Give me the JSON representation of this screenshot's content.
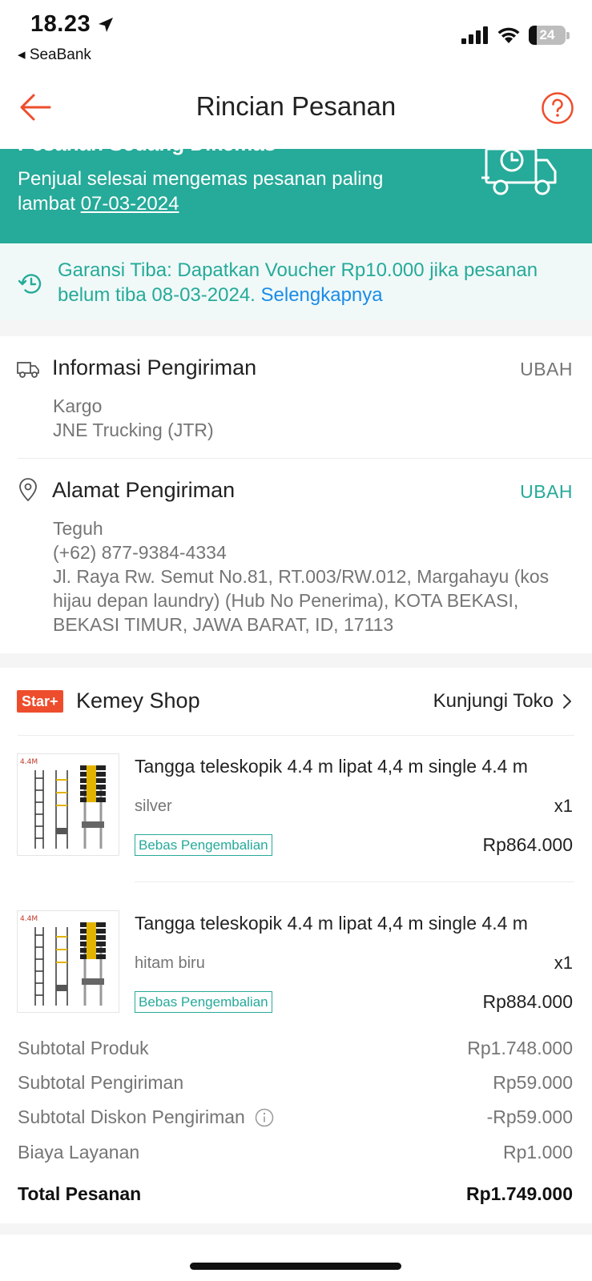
{
  "status_bar": {
    "time": "18.23",
    "back_app": "◂ SeaBank",
    "battery": "24"
  },
  "header": {
    "title": "Rincian Pesanan"
  },
  "banner": {
    "title_cut": "Pesanan Sedang Dikemas",
    "text_before": "Penjual selesai mengemas pesanan paling lambat ",
    "date": "07-03-2024",
    "color": "#26aa99"
  },
  "guarantee": {
    "text": "Garansi Tiba: Dapatkan Voucher Rp10.000 jika pesanan belum tiba 08-03-2024. ",
    "link": "Selengkapnya"
  },
  "shipping_info": {
    "title": "Informasi Pengiriman",
    "action": "UBAH",
    "line1": "Kargo",
    "line2": "JNE Trucking (JTR)"
  },
  "address": {
    "title": "Alamat Pengiriman",
    "action": "UBAH",
    "name": "Teguh",
    "phone": "(+62) 877-9384-4334",
    "address": "Jl. Raya Rw. Semut No.81, RT.003/RW.012, Margahayu (kos hijau depan laundry) (Hub No Penerima), KOTA BEKASI, BEKASI TIMUR, JAWA BARAT, ID, 17113"
  },
  "shop": {
    "badge": "Star+",
    "name": "Kemey Shop",
    "visit": "Kunjungi Toko"
  },
  "products": [
    {
      "name": "Tangga teleskopik 4.4 m lipat 4,4 m single 4.4 m",
      "variant": "silver",
      "qty": "x1",
      "badge": "Bebas Pengembalian",
      "price": "Rp864.000",
      "img_label": "4.4M"
    },
    {
      "name": "Tangga teleskopik 4.4 m lipat 4,4 m single 4.4 m",
      "variant": "hitam biru",
      "qty": "x1",
      "badge": "Bebas Pengembalian",
      "price": "Rp884.000",
      "img_label": "4.4M"
    }
  ],
  "summary": {
    "subtotal_product_label": "Subtotal Produk",
    "subtotal_product": "Rp1.748.000",
    "subtotal_shipping_label": "Subtotal Pengiriman",
    "subtotal_shipping": "Rp59.000",
    "shipping_discount_label": "Subtotal Diskon Pengiriman",
    "shipping_discount": "-Rp59.000",
    "service_fee_label": "Biaya Layanan",
    "service_fee": "Rp1.000",
    "total_label": "Total Pesanan",
    "total": "Rp1.749.000"
  },
  "colors": {
    "accent": "#ee4d2d",
    "teal": "#26aa99",
    "link": "#1a8ce8"
  }
}
